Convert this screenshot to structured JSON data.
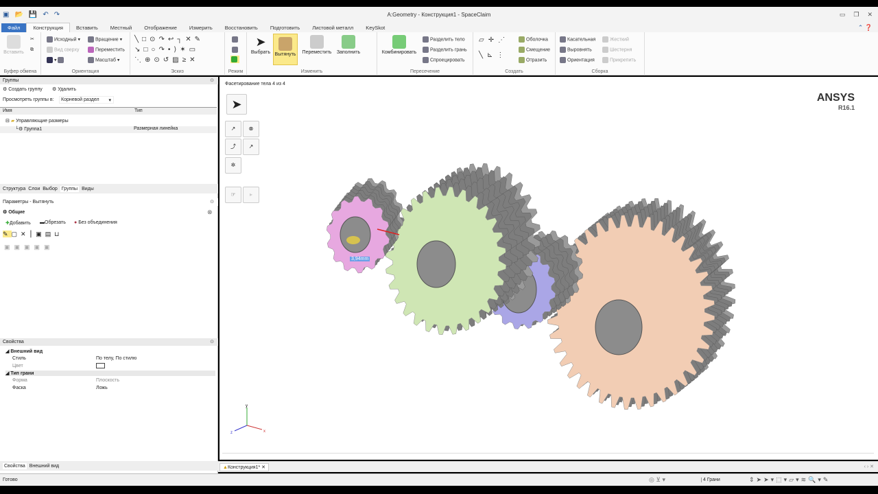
{
  "window": {
    "title": "A:Geometry - Конструкция1 - SpaceClaim"
  },
  "tabs": [
    "Файл",
    "Конструкция",
    "Вставить",
    "Местный",
    "Отображение",
    "Измерить",
    "Восстановить",
    "Подготовить",
    "Листовой металл",
    "KeySkot"
  ],
  "ribbon": {
    "groups": [
      "Буфер обмена",
      "Ориентация",
      "Эскиз",
      "Режим",
      "Изменить",
      "Пересечение",
      "Создать",
      "Сборка"
    ],
    "clipboard": {
      "paste": "Вставить"
    },
    "orientation": {
      "home": "Исходный",
      "rotate": "Вращение",
      "top_view": "Вид сверху",
      "pan": "Переместить",
      "zoom": "Масштаб"
    },
    "edit": {
      "select": "Выбрать",
      "pull": "Вытянуть",
      "move": "Переместить",
      "fill": "Заполнить"
    },
    "intersect": {
      "combine": "Комбинировать",
      "split_body": "Разделить тело",
      "split_face": "Разделить грань",
      "project": "Спроецировать"
    },
    "create": {
      "shell": "Оболочка",
      "offset": "Смещение",
      "mirror": "Отразить"
    },
    "assembly": {
      "tangent": "Касательная",
      "align": "Выровнять",
      "orient": "Ориентация",
      "rigid": "Жесткий",
      "gear": "Шестерня",
      "anchor": "Прикрепить"
    }
  },
  "groups_panel": {
    "title": "Группы",
    "create": "Создать группу",
    "delete": "Удалить",
    "view_label": "Просмотреть группы в:",
    "view_value": "Корневой раздел",
    "col_name": "Имя",
    "col_type": "Тип",
    "tree": [
      {
        "name": "Управляющие размеры",
        "type": ""
      },
      {
        "name": "Группа1",
        "type": "Размерная линейка"
      }
    ]
  },
  "panel_tabs": [
    "Структура",
    "Слои",
    "Выбор",
    "Группы",
    "Виды"
  ],
  "options_panel": {
    "title": "Параметры - Вытянуть",
    "section": "Общие",
    "add": "Добавить",
    "cut": "Обрезать",
    "no_merge": "Без объединения"
  },
  "properties": {
    "title": "Свойства",
    "sections": [
      {
        "name": "Внешний вид",
        "rows": [
          {
            "k": "Стиль",
            "v": "По телу, По стилю"
          },
          {
            "k": "Цвет",
            "v": ""
          }
        ]
      },
      {
        "name": "Тип грани",
        "rows": [
          {
            "k": "Форма",
            "v": "Плоскость"
          },
          {
            "k": "Фаска",
            "v": "Ложь"
          }
        ]
      }
    ]
  },
  "props_tabs": [
    "Свойства",
    "Внешний вид"
  ],
  "viewport": {
    "status": "Фасетирование тела 4 из 4",
    "brand": "ANSYS",
    "version": "R16.1",
    "dim_label": "3,94mm",
    "doc_tab": "Конструкция1*"
  },
  "status": {
    "text": "Готово",
    "selection": "4 Грани"
  },
  "colors": {
    "pink": "#e7a8e0",
    "green": "#cfe6b4",
    "purple": "#aaa6e6",
    "peach": "#f2cdb4",
    "accent": "#3a74c4"
  }
}
